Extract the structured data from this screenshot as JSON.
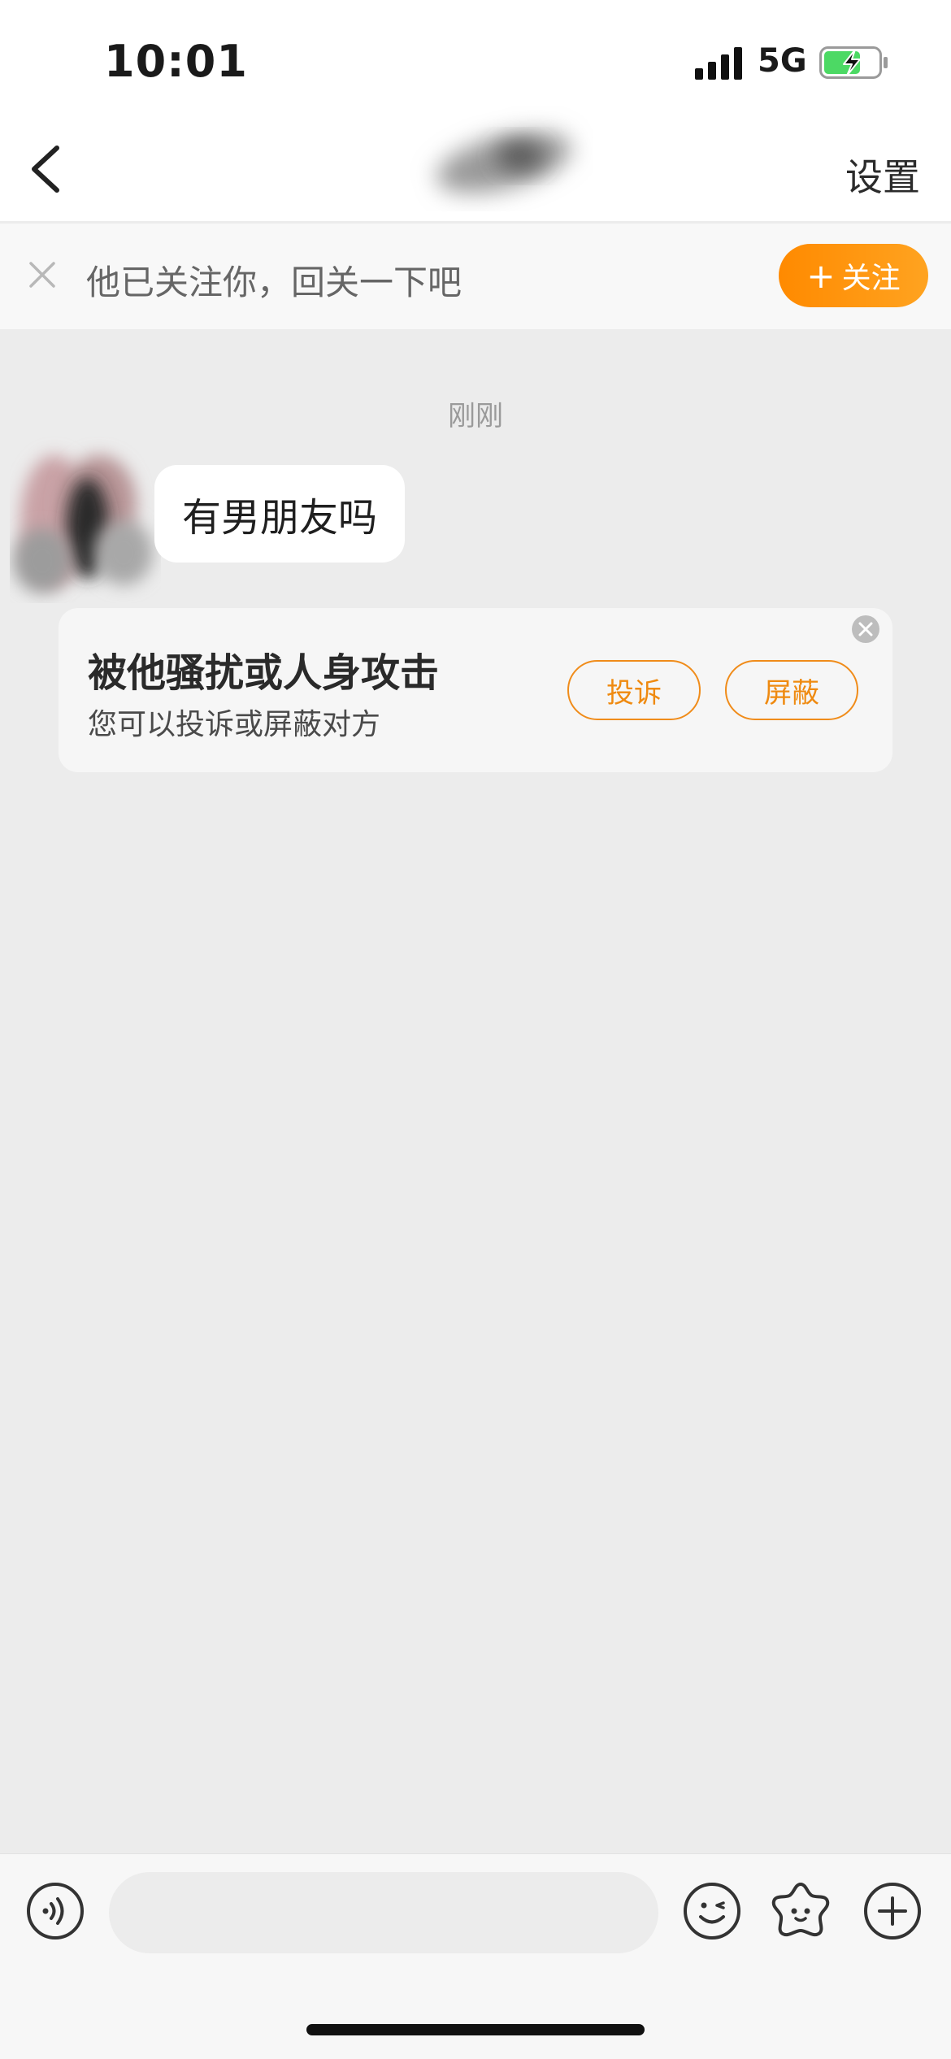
{
  "status_bar": {
    "time": "10:01",
    "network": "5G"
  },
  "nav": {
    "settings_label": "设置"
  },
  "follow_banner": {
    "text": "他已关注你，回关一下吧",
    "follow_label": "关注",
    "follow_plus": "+"
  },
  "chat": {
    "timestamp": "刚刚",
    "messages": [
      {
        "text": "有男朋友吗",
        "from": "other"
      }
    ]
  },
  "harass_card": {
    "title": "被他骚扰或人身攻击",
    "subtitle": "您可以投诉或屏蔽对方",
    "report_label": "投诉",
    "block_label": "屏蔽"
  },
  "input": {
    "placeholder": ""
  },
  "colors": {
    "accent": "#ff8a00",
    "accent_text": "#ef8a10",
    "background": "#ececec",
    "battery": "#4cd964"
  }
}
